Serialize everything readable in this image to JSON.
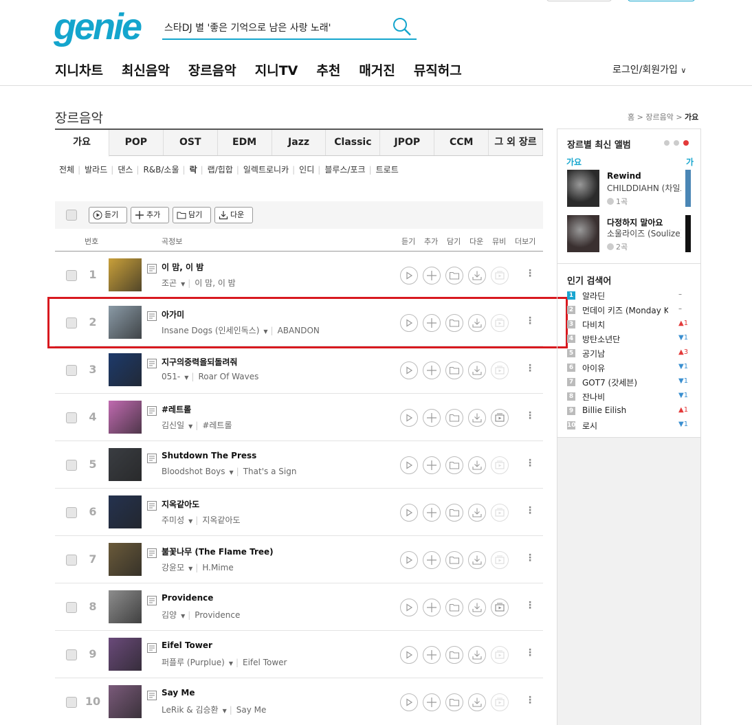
{
  "header": {
    "logo": "genie",
    "search_value": "스타DJ 별 '좋은 기억으로 남은 사랑 노래'",
    "login": "로그인/회원가입"
  },
  "gnb": [
    "지니차트",
    "최신음악",
    "장르음악",
    "지니TV",
    "추천",
    "매거진",
    "뮤직허그"
  ],
  "page": {
    "title": "장르음악",
    "crumb_home": "홈",
    "crumb_mid": "장르음악",
    "crumb_cur": "가요"
  },
  "tabs": [
    "가요",
    "POP",
    "OST",
    "EDM",
    "Jazz",
    "Classic",
    "JPOP",
    "CCM",
    "그 외 장르"
  ],
  "subgenres": [
    "전체",
    "발라드",
    "댄스",
    "R&B/소울",
    "락",
    "랩/힙합",
    "일렉트로니카",
    "인디",
    "블루스/포크",
    "트로트"
  ],
  "toolbar": {
    "listen": "듣기",
    "add": "추가",
    "save": "담기",
    "download": "다운"
  },
  "columns": {
    "num": "번호",
    "info": "곡정보",
    "listen": "듣기",
    "add": "추가",
    "save": "담기",
    "down": "다운",
    "mv": "뮤비",
    "more": "더보기"
  },
  "songs": [
    {
      "num": "1",
      "title": "이 맘, 이 밤",
      "artist": "조곤",
      "album": "이 맘, 이 밤",
      "cover": "#c9a03a",
      "mv": false
    },
    {
      "num": "2",
      "title": "아가미",
      "artist": "Insane Dogs (인세인독스)",
      "album": "ABANDON",
      "cover": "#8a9aa6",
      "mv": false
    },
    {
      "num": "3",
      "title": "지구의중력을되돌려줘",
      "artist": "051-",
      "album": "Roar Of Waves",
      "cover": "#1d3a6b",
      "mv": false
    },
    {
      "num": "4",
      "title": "#레트롤",
      "artist": "김신일",
      "album": "#레트롤",
      "cover": "#c06ab0",
      "mv": true
    },
    {
      "num": "5",
      "title": "Shutdown The Press",
      "artist": "Bloodshot Boys",
      "album": "That's a Sign",
      "cover": "#3a3d42",
      "mv": false
    },
    {
      "num": "6",
      "title": "지옥같아도",
      "artist": "주미성",
      "album": "지옥같아도",
      "cover": "#24324f",
      "mv": false
    },
    {
      "num": "7",
      "title": "불꽃나무 (The Flame Tree)",
      "artist": "강윤모",
      "album": "H.Mime",
      "cover": "#6a5a3a",
      "mv": false
    },
    {
      "num": "8",
      "title": "Providence",
      "artist": "김양",
      "album": "Providence",
      "cover": "#8d8d8d",
      "mv": true
    },
    {
      "num": "9",
      "title": "Eifel Tower",
      "artist": "퍼플루 (Purplue)",
      "album": "Eifel Tower",
      "cover": "#6a4a7a",
      "mv": false
    },
    {
      "num": "10",
      "title": "Say Me",
      "artist": "LeRik & 김승환",
      "album": "Say Me",
      "cover": "#7a5a7a",
      "mv": false
    }
  ],
  "sidebar": {
    "albums_title": "장르별 최신 앨범",
    "genre_label": "가요",
    "genre_label2": "가",
    "albums": [
      {
        "title": "Rewind",
        "artist": "CHILDDIAHN (차일드디안)",
        "count": "1곡",
        "cover": "#2b2b2b",
        "bar": "#4a86b5"
      },
      {
        "title": "다정하지 말아요",
        "artist": "소울라이즈 (Soulize)",
        "count": "2곡",
        "cover": "#3a3030",
        "bar": "#111111"
      }
    ],
    "keywords_title": "인기 검색어",
    "keywords": [
      {
        "rank": "1",
        "text": "알라딘",
        "change": "–",
        "dir": "st"
      },
      {
        "rank": "2",
        "text": "먼데이 키즈 (Monday Kiz)",
        "change": "–",
        "dir": "st"
      },
      {
        "rank": "3",
        "text": "다비치",
        "change": "▲1",
        "dir": "up"
      },
      {
        "rank": "4",
        "text": "방탄소년단",
        "change": "▼1",
        "dir": "dn"
      },
      {
        "rank": "5",
        "text": "공기남",
        "change": "▲3",
        "dir": "up"
      },
      {
        "rank": "6",
        "text": "아이유",
        "change": "▼1",
        "dir": "dn"
      },
      {
        "rank": "7",
        "text": "GOT7 (갓세븐)",
        "change": "▼1",
        "dir": "dn"
      },
      {
        "rank": "8",
        "text": "잔나비",
        "change": "▼1",
        "dir": "dn"
      },
      {
        "rank": "9",
        "text": "Billie Eilish",
        "change": "▲1",
        "dir": "up"
      },
      {
        "rank": "10",
        "text": "로시",
        "change": "▼1",
        "dir": "dn"
      }
    ]
  },
  "colors": {
    "brand": "#14a5cd",
    "highlight": "#d8191f"
  }
}
